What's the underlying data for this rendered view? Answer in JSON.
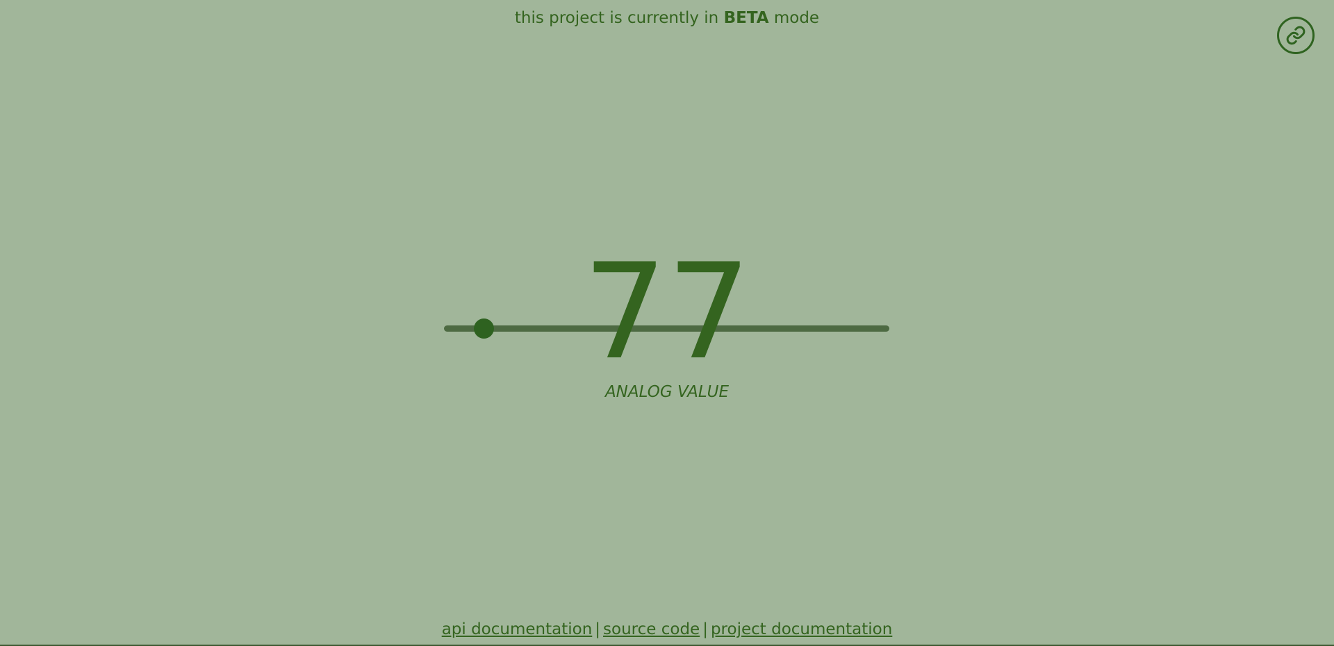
{
  "banner": {
    "prefix": "this project is currently in ",
    "emphasis": "BETA",
    "suffix": " mode"
  },
  "link_button": {
    "icon": "link-icon"
  },
  "slider": {
    "value": 77,
    "min": 0,
    "max": 1023
  },
  "display": {
    "value": "77",
    "label": "ANALOG VALUE"
  },
  "footer": {
    "links": [
      {
        "label": "api documentation"
      },
      {
        "label": "source code"
      },
      {
        "label": "project documentation"
      }
    ],
    "separator": "|"
  },
  "colors": {
    "background": "#a1b69a",
    "accent": "#34641f",
    "track": "#4d6a42"
  }
}
